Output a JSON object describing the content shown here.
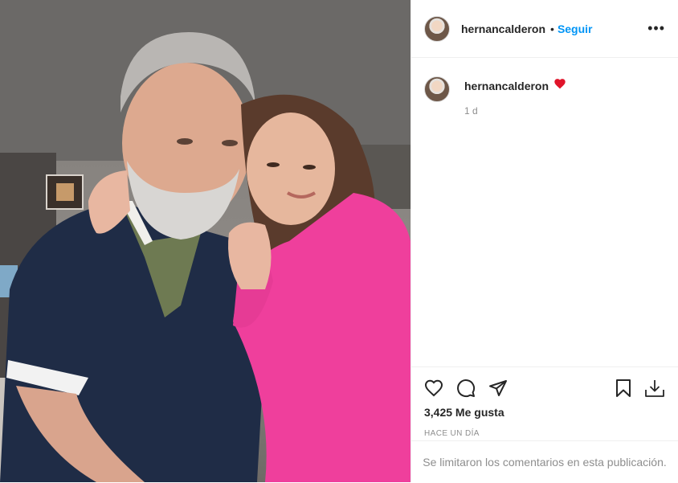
{
  "post": {
    "username": "hernancalderon",
    "follow_label": "Seguir",
    "dot": "•",
    "more_label": "•••",
    "caption_emoji": "❤️",
    "time_ago": "1 d",
    "likes": "3,425 Me gusta",
    "timestamp": "HACE UN DÍA",
    "comments_notice": "Se limitaron los comentarios en esta publicación."
  },
  "colors": {
    "accent": "#0095f6",
    "muted": "#8e8e8e",
    "text": "#262626",
    "heart": "#ed4956"
  },
  "icons": [
    "heart-icon",
    "comment-icon",
    "share-icon",
    "bookmark-icon",
    "download-icon"
  ]
}
